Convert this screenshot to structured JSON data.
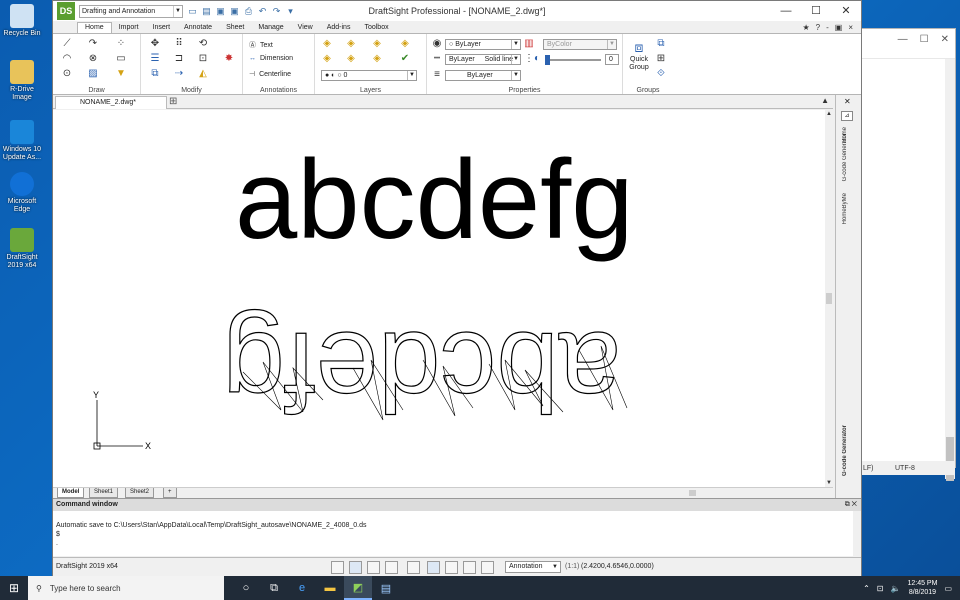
{
  "desktop": {
    "icons": [
      {
        "label": "Recycle Bin",
        "icon": "recycle-bin-icon"
      },
      {
        "label": "R-Drive Image",
        "icon": "r-drive-icon"
      },
      {
        "label": "Windows 10 Update As...",
        "icon": "windows-update-icon"
      },
      {
        "label": "Microsoft Edge",
        "icon": "edge-icon"
      },
      {
        "label": "DraftSight 2019 x64",
        "icon": "draftsight-icon"
      }
    ]
  },
  "bg_window": {
    "status_a": "LF)",
    "status_b": "UTF-8"
  },
  "app": {
    "title": "DraftSight Professional - [NONAME_2.dwg*]",
    "workspace": "Drafting and Annotation",
    "help_controls": [
      "★",
      "?",
      "-",
      "▣",
      "×"
    ],
    "window_controls": [
      "—",
      "☐",
      "✕"
    ]
  },
  "ribbon": {
    "tabs": [
      "Home",
      "Import",
      "Insert",
      "Annotate",
      "Sheet",
      "Manage",
      "View",
      "Add-ins",
      "Toolbox"
    ],
    "active_tab": "Home",
    "groups": {
      "draw": "Draw",
      "modify": "Modify",
      "annotations": "Annotations",
      "layers": "Layers",
      "properties": "Properties",
      "groups": "Groups"
    },
    "annotation_items": [
      "Text",
      "Dimension",
      "Centerline"
    ],
    "layer_current": "0",
    "properties": {
      "color": "ByLayer",
      "linetype_layer": "ByLayer",
      "linetype": "Solid line",
      "lineweight": "ByLayer",
      "bycolor": "ByColor",
      "transparency": "0"
    },
    "quick_group": "Quick Group"
  },
  "document": {
    "tab": "NONAME_2.dwg*",
    "sheet_tabs": [
      "Model",
      "Sheet1",
      "Sheet2"
    ],
    "drawing_text": "abcdefg",
    "side_tabs": [
      "Home",
      "G-code Generator",
      "HomeByMe",
      "G-code Generator"
    ],
    "axis_x": "X",
    "axis_y": "Y"
  },
  "command": {
    "title": "Command window",
    "lines": [
      "Automatic save to C:\\Users\\Stan\\AppData\\Local\\Temp\\DraftSight_autosave\\NONAME_2_4008_0.ds",
      "$",
      "."
    ]
  },
  "status": {
    "version": "DraftSight 2019 x64",
    "annotation_scale": "Annotation",
    "scale": "(1:1)",
    "coords": "(2.4200,4.6546,0.0000)"
  },
  "taskbar": {
    "search_placeholder": "Type here to search",
    "time": "12:45 PM",
    "date": "8/8/2019"
  }
}
